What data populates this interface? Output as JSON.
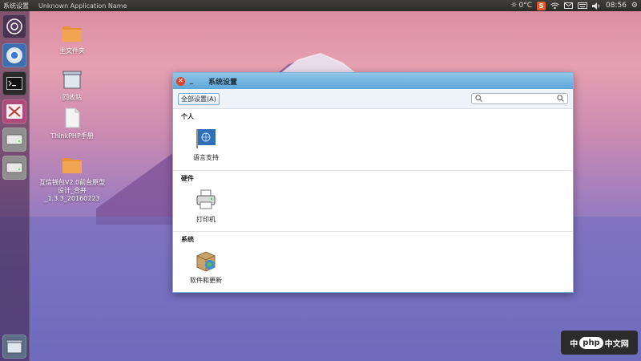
{
  "topbar": {
    "app_title": "系统设置",
    "window_name": "Unknown Application Name",
    "weather": "0°C",
    "time": "08:56",
    "sogou_label": "S"
  },
  "launcher": {
    "items": [
      {
        "name": "dash",
        "icon": "ubuntu-logo-icon"
      },
      {
        "name": "chrome",
        "icon": "chrome-icon"
      },
      {
        "name": "terminal",
        "icon": "terminal-icon"
      },
      {
        "name": "system-settings",
        "icon": "settings-icon"
      },
      {
        "name": "drive-1",
        "icon": "drive-icon"
      },
      {
        "name": "drive-2",
        "icon": "drive-icon"
      },
      {
        "name": "trash",
        "icon": "trash-icon"
      }
    ]
  },
  "desktop": {
    "icons": [
      {
        "label": "主文件夹"
      },
      {
        "label": "回收站"
      },
      {
        "label": "ThinkPHP手册"
      },
      {
        "label": "互信钱包V2.0前台原型设计_合并_1.3.3_20160223"
      }
    ]
  },
  "window": {
    "title": "系统设置",
    "all_settings_label": "全部设置(A)",
    "search_placeholder": "",
    "sections": [
      {
        "title": "个人",
        "items": [
          {
            "label": "语言支持"
          }
        ]
      },
      {
        "title": "硬件",
        "items": [
          {
            "label": "打印机"
          }
        ]
      },
      {
        "title": "系统",
        "items": [
          {
            "label": "软件和更新"
          }
        ]
      }
    ]
  },
  "badge": {
    "text_left": "中",
    "text_php": "php",
    "text_right": "中文网"
  },
  "colors": {
    "accent": "#5ea6d8",
    "close": "#d9432e"
  }
}
